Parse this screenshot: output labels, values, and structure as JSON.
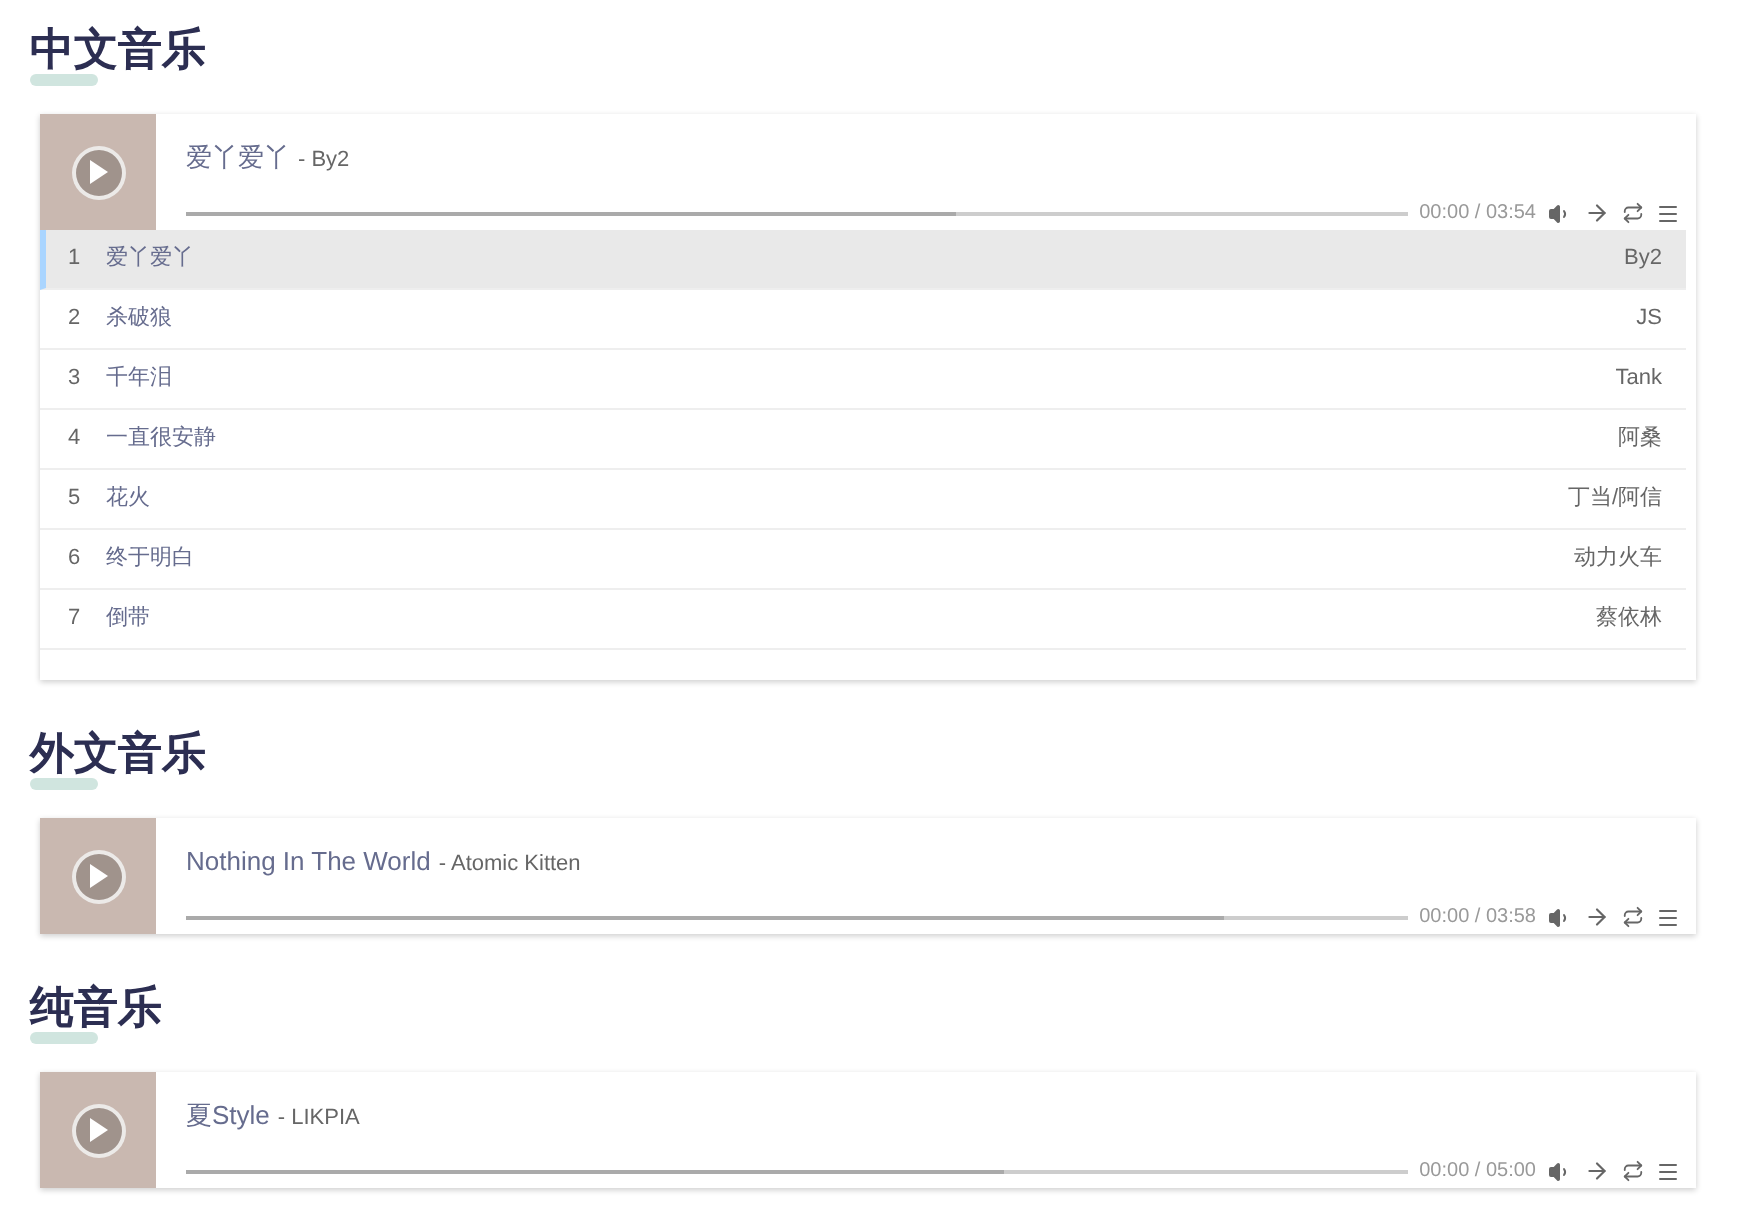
{
  "sections": [
    {
      "heading": "中文音乐",
      "player": {
        "title": "爱丫爱丫",
        "artist": "- By2",
        "time": "00:00 / 03:54",
        "level": 0.63
      },
      "playlist": [
        {
          "number": "1",
          "title": "爱丫爱丫",
          "artist": "By2",
          "selected": true
        },
        {
          "number": "2",
          "title": "杀破狼",
          "artist": "JS",
          "selected": false
        },
        {
          "number": "3",
          "title": "千年泪",
          "artist": "Tank",
          "selected": false
        },
        {
          "number": "4",
          "title": "一直很安静",
          "artist": "阿桑",
          "selected": false
        },
        {
          "number": "5",
          "title": "花火",
          "artist": "丁当/阿信",
          "selected": false
        },
        {
          "number": "6",
          "title": "终于明白",
          "artist": "动力火车",
          "selected": false
        },
        {
          "number": "7",
          "title": "倒带",
          "artist": "蔡依林",
          "selected": false
        }
      ]
    },
    {
      "heading": "外文音乐",
      "player": {
        "title": "Nothing In The World",
        "artist": "- Atomic Kitten",
        "time": "00:00 / 03:58",
        "level": 0.85
      }
    },
    {
      "heading": "纯音乐",
      "player": {
        "title": "夏Style",
        "artist": "- LIKPIA",
        "time": "00:00 / 05:00",
        "level": 0.67
      }
    }
  ]
}
